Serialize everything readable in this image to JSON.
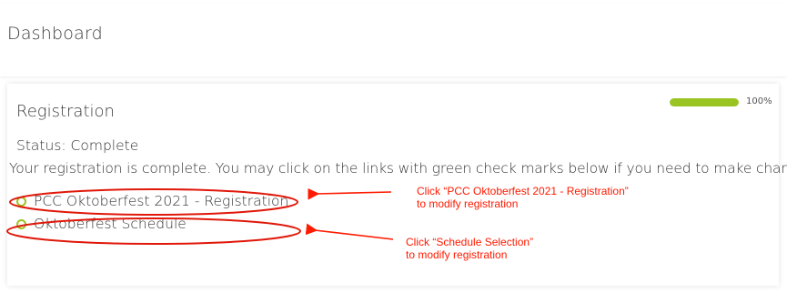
{
  "header": {
    "title": "Dashboard"
  },
  "registration_card": {
    "title": "Registration",
    "progress": {
      "percent": 100,
      "label": "100%",
      "fill_color": "#9ac421",
      "track_color": "#e3e3e3"
    },
    "status": "Status: Complete",
    "message": "Your registration is complete. You may click on the links with green check marks below if you need to make changes.",
    "links": [
      {
        "label": "PCC Oktoberfest 2021 - Registration",
        "icon": "green-check-circle-icon"
      },
      {
        "label": "Oktoberfest Schedule",
        "icon": "green-check-circle-icon"
      }
    ]
  },
  "annotations": {
    "color": "#ff1a00",
    "note_1": {
      "line_1": "Click “PCC Oktoberfest 2021 - Registration”",
      "line_2": "to modify registration"
    },
    "note_2": {
      "line_1": "Click “Schedule Selection”",
      "line_2": "to modify registration"
    }
  }
}
